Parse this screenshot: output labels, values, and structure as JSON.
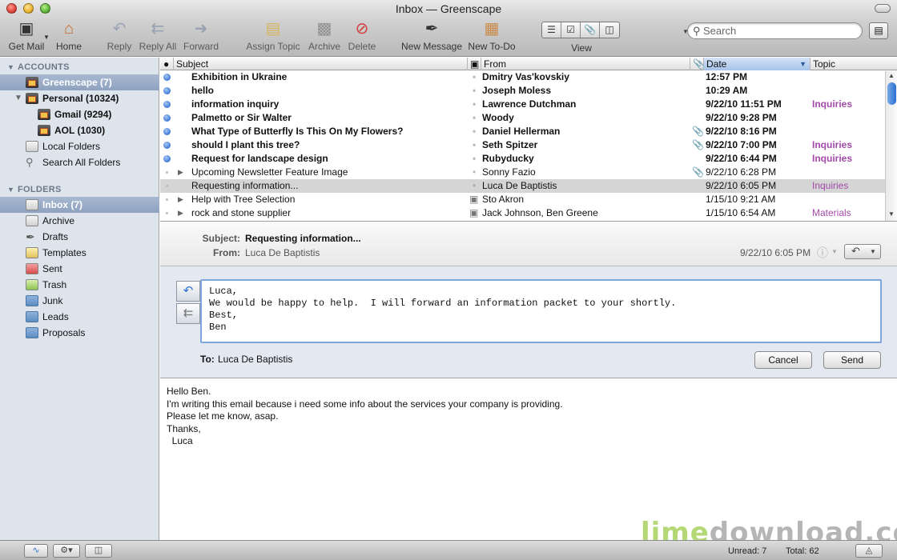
{
  "window": {
    "title": "Inbox — Greenscape"
  },
  "toolbar": {
    "get_mail": "Get Mail",
    "home": "Home",
    "reply": "Reply",
    "reply_all": "Reply All",
    "forward": "Forward",
    "assign_topic": "Assign Topic",
    "archive": "Archive",
    "delete": "Delete",
    "new_message": "New Message",
    "new_todo": "New To-Do",
    "view": "View",
    "search_placeholder": "Search"
  },
  "sidebar": {
    "accounts_header": "ACCOUNTS",
    "accounts": [
      {
        "label": "Greenscape (7)"
      },
      {
        "label": "Personal (10324)"
      },
      {
        "label": "Gmail (9294)"
      },
      {
        "label": "AOL (1030)"
      },
      {
        "label": "Local Folders"
      },
      {
        "label": "Search All Folders"
      }
    ],
    "folders_header": "FOLDERS",
    "folders": [
      {
        "label": "Inbox (7)"
      },
      {
        "label": "Archive"
      },
      {
        "label": "Drafts"
      },
      {
        "label": "Templates"
      },
      {
        "label": "Sent"
      },
      {
        "label": "Trash"
      },
      {
        "label": "Junk"
      },
      {
        "label": "Leads"
      },
      {
        "label": "Proposals"
      }
    ]
  },
  "message_list": {
    "columns": {
      "subject": "Subject",
      "from": "From",
      "date": "Date",
      "topic": "Topic"
    },
    "rows": [
      {
        "subject": "Exhibition in Ukraine",
        "from": "Dmitry Vas'kovskiy",
        "date": "12:57 PM",
        "topic": ""
      },
      {
        "subject": "hello",
        "from": "Joseph Moless",
        "date": "10:29 AM",
        "topic": ""
      },
      {
        "subject": "information inquiry",
        "from": "Lawrence Dutchman",
        "date": "9/22/10 11:51 PM",
        "topic": "Inquiries"
      },
      {
        "subject": "Palmetto or Sir Walter",
        "from": "Woody",
        "date": "9/22/10 9:28 PM",
        "topic": ""
      },
      {
        "subject": "What Type of Butterfly Is This On My Flowers?",
        "from": "Daniel Hellerman",
        "date": "9/22/10 8:16 PM",
        "topic": ""
      },
      {
        "subject": "should I plant this tree?",
        "from": "Seth Spitzer",
        "date": "9/22/10 7:00 PM",
        "topic": "Inquiries"
      },
      {
        "subject": "Request for landscape design",
        "from": "Rubyducky",
        "date": "9/22/10 6:44 PM",
        "topic": "Inquiries"
      },
      {
        "subject": "Upcoming Newsletter Feature Image",
        "from": "Sonny Fazio",
        "date": "9/22/10 6:28 PM",
        "topic": ""
      },
      {
        "subject": "Requesting information...",
        "from": "Luca De Baptistis",
        "date": "9/22/10 6:05 PM",
        "topic": "Inquiries"
      },
      {
        "subject": "Help with Tree Selection",
        "from": "Sto Akron",
        "date": "1/15/10 9:21 AM",
        "topic": ""
      },
      {
        "subject": "rock and stone supplier",
        "from": "Jack Johnson, Ben Greene",
        "date": "1/15/10 6:54 AM",
        "topic": "Materials"
      }
    ]
  },
  "preview": {
    "subject_label": "Subject:",
    "subject": "Requesting information...",
    "from_label": "From:",
    "from": "Luca De Baptistis",
    "date": "9/22/10 6:05 PM"
  },
  "reply": {
    "text": "Luca,\nWe would be happy to help.  I will forward an information packet to your shortly.\nBest,\nBen",
    "to_label": "To:",
    "to": "Luca De Baptistis",
    "cancel": "Cancel",
    "send": "Send"
  },
  "body": {
    "text": "Hello Ben.\nI'm writing this email because i need some info about the services your company is providing.\nPlease let me know, asap.\nThanks,\n  Luca"
  },
  "status": {
    "unread": "Unread: 7",
    "total": "Total: 62"
  },
  "watermark": {
    "part1": "lime",
    "part2": "download.com"
  },
  "colors": {
    "topic": "#a24aa8",
    "selection": "#8ea2c0",
    "accent": "#2f6fd1"
  }
}
